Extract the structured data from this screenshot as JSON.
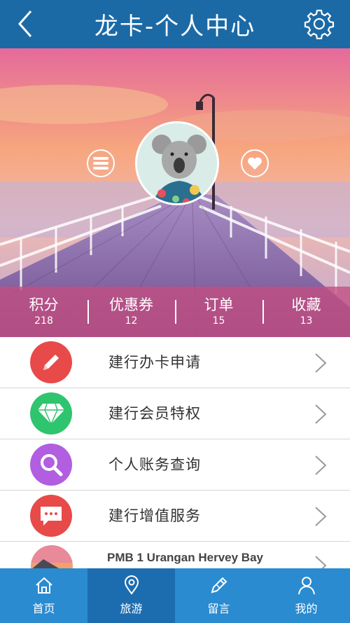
{
  "header": {
    "title": "龙卡-个人中心"
  },
  "stats": [
    {
      "label": "积分",
      "value": "218"
    },
    {
      "label": "优惠券",
      "value": "12"
    },
    {
      "label": "订单",
      "value": "15"
    },
    {
      "label": "收藏",
      "value": "13"
    }
  ],
  "menu": [
    {
      "label": "建行办卡申请",
      "icon": "pencil-icon",
      "color": "#e84a4a"
    },
    {
      "label": "建行会员特权",
      "icon": "diamond-icon",
      "color": "#2fc46e"
    },
    {
      "label": "个人账务查询",
      "icon": "search-icon",
      "color": "#b15ee0"
    },
    {
      "label": "建行增值服务",
      "icon": "chat-icon",
      "color": "#e84a4a"
    }
  ],
  "partial_item": {
    "label": "PMB 1 Urangan Hervey Bay"
  },
  "tabs": [
    {
      "label": "首页",
      "icon": "home-icon"
    },
    {
      "label": "旅游",
      "icon": "location-icon",
      "active": true
    },
    {
      "label": "留言",
      "icon": "pen-icon"
    },
    {
      "label": "我的",
      "icon": "user-icon"
    }
  ]
}
